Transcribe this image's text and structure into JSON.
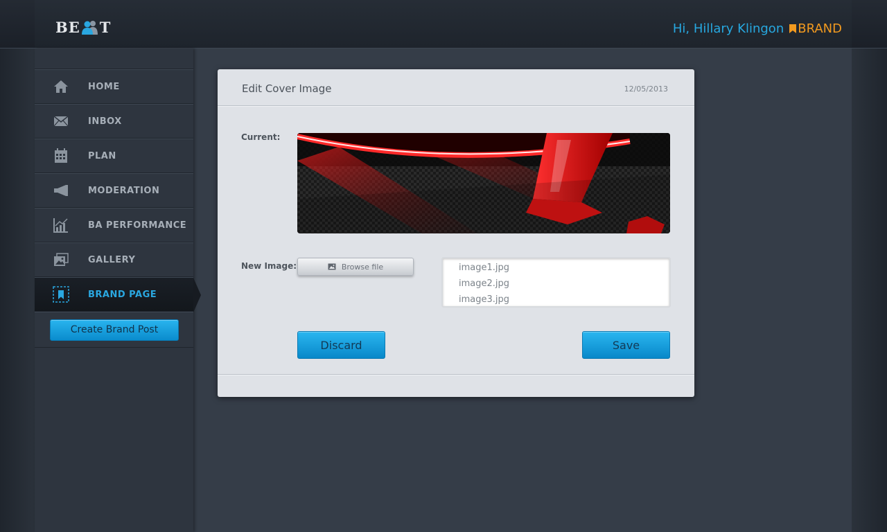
{
  "header": {
    "logo_left": "BE",
    "logo_right": "T",
    "greeting": "Hi, Hillary Klingon",
    "brand_tag": "BRAND"
  },
  "sidebar": {
    "items": [
      {
        "label": "HOME",
        "icon": "home-icon",
        "active": false
      },
      {
        "label": "INBOX",
        "icon": "envelope-icon",
        "active": false
      },
      {
        "label": "PLAN",
        "icon": "calendar-icon",
        "active": false
      },
      {
        "label": "MODERATION",
        "icon": "megaphone-icon",
        "active": false
      },
      {
        "label": "BA PERFORMANCE",
        "icon": "chart-icon",
        "active": false
      },
      {
        "label": "GALLERY",
        "icon": "gallery-icon",
        "active": false
      },
      {
        "label": "BRAND PAGE",
        "icon": "bookmark-icon",
        "active": true
      }
    ],
    "create_button": "Create Brand Post"
  },
  "dialog": {
    "title": "Edit Cover Image",
    "date": "12/05/2013",
    "current_label": "Current:",
    "new_image_label": "New Image:",
    "browse_label": "Browse file",
    "files": [
      "image1.jpg",
      "image2.jpg",
      "image3.jpg"
    ],
    "discard_label": "Discard",
    "save_label": "Save"
  },
  "colors": {
    "accent_blue": "#27a8e0",
    "brand_orange": "#f29a1f",
    "background": "#353d48"
  }
}
